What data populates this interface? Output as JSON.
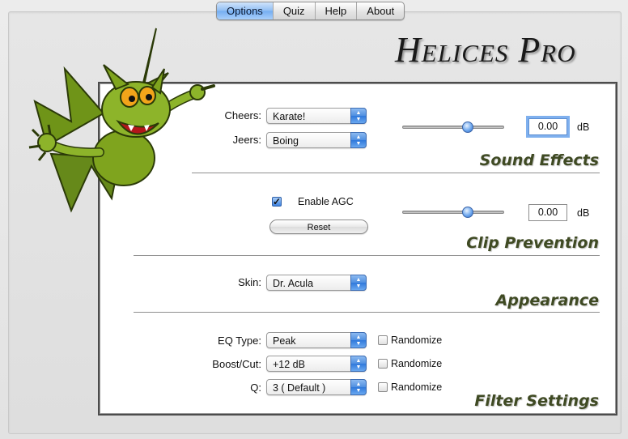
{
  "app": {
    "title": "Helices Pro"
  },
  "tabs": [
    {
      "label": "Options",
      "active": true
    },
    {
      "label": "Quiz",
      "active": false
    },
    {
      "label": "Help",
      "active": false
    },
    {
      "label": "About",
      "active": false
    }
  ],
  "sound_effects": {
    "title": "Sound Effects",
    "cheers_label": "Cheers:",
    "cheers_value": "Karate!",
    "jeers_label": "Jeers:",
    "jeers_value": "Boing",
    "gain_value": "0.00",
    "gain_unit": "dB",
    "slider_level": 0.64
  },
  "clip_prevention": {
    "title": "Clip Prevention",
    "agc_label": "Enable AGC",
    "agc_checked": true,
    "reset_label": "Reset",
    "gain_value": "0.00",
    "gain_unit": "dB",
    "slider_level": 0.64
  },
  "appearance": {
    "title": "Appearance",
    "skin_label": "Skin:",
    "skin_value": "Dr. Acula"
  },
  "filter_settings": {
    "title": "Filter Settings",
    "eq_type_label": "EQ Type:",
    "eq_type_value": "Peak",
    "boost_label": "Boost/Cut:",
    "boost_value": "+12 dB",
    "q_label": "Q:",
    "q_value": "3 ( Default )",
    "randomize_label": "Randomize"
  },
  "icons": {
    "mascot": "dragon-mascot-icon",
    "popup_arrows": "up-down-arrows-icon"
  },
  "colors": {
    "accent": "#74adf1",
    "section_title": "#3f4a23",
    "mascot_green": "#7fa41e"
  }
}
